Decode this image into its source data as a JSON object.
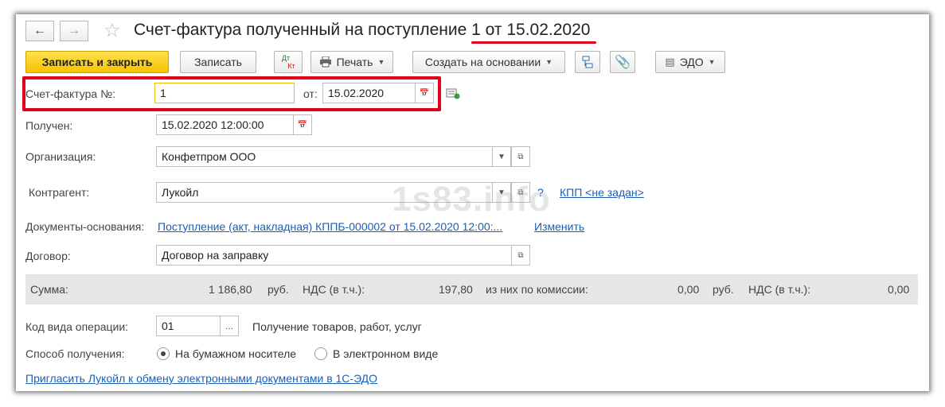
{
  "header": {
    "title_prefix": "Счет-фактура полученный на поступление",
    "title_number": "1 от 15.02.2020"
  },
  "toolbar": {
    "save_close": "Записать и закрыть",
    "save": "Записать",
    "dtkt_top": "Дт",
    "dtkt_bottom": "Кт",
    "print": "Печать",
    "create_based": "Создать на основании",
    "edo": "ЭДО"
  },
  "form": {
    "invoice_label": "Счет-фактура №:",
    "invoice_number": "1",
    "from_label": "от:",
    "invoice_date": "15.02.2020",
    "received_label": "Получен:",
    "received_value": "15.02.2020 12:00:00",
    "org_label": "Организация:",
    "org_value": "Конфетпром ООО",
    "contractor_label": "Контрагент:",
    "contractor_value": "Лукойл",
    "question": "?",
    "kpp_link": "КПП <не задан>",
    "base_docs_label": "Документы-основания:",
    "base_docs_link": "Поступление (акт, накладная) КППБ-000002 от 15.02.2020 12:00:...",
    "change_link": "Изменить",
    "contract_label": "Договор:",
    "contract_value": "Договор на заправку"
  },
  "summary": {
    "sum_label": "Сумма:",
    "sum_value": "1 186,80",
    "rub1": "руб.",
    "vat_label1": "НДС (в т.ч.):",
    "vat_value1": "197,80",
    "commission_label": "из них по комиссии:",
    "commission_value": "0,00",
    "rub2": "руб.",
    "vat_label2": "НДС (в т.ч.):",
    "vat_value2": "0,00"
  },
  "operation": {
    "code_label": "Код вида операции:",
    "code_value": "01",
    "code_desc": "Получение товаров, работ, услуг"
  },
  "receipt": {
    "label": "Способ получения:",
    "option_paper": "На бумажном носителе",
    "option_electronic": "В электронном виде",
    "selected": "На бумажном носителе"
  },
  "invite_link": "Пригласить Лукойл к обмену электронными документами в 1С-ЭДО",
  "watermark": "1s83.info",
  "colors": {
    "accent_yellow": "#f5c400",
    "highlight_red": "#e0001b",
    "link_blue": "#1a5fb4"
  }
}
